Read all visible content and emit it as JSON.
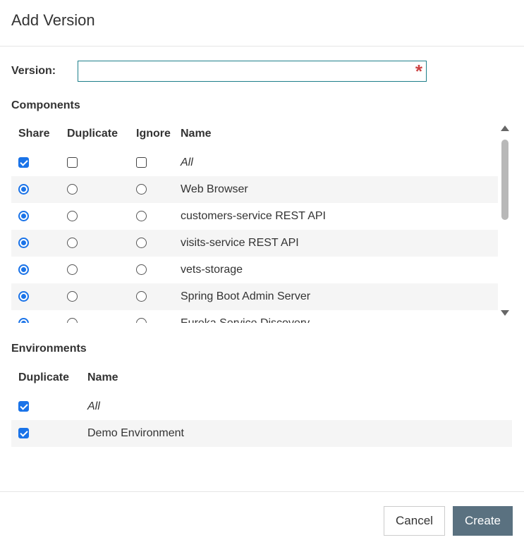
{
  "dialog": {
    "title": "Add Version"
  },
  "version": {
    "label": "Version:",
    "value": "",
    "required_mark": "*"
  },
  "components": {
    "title": "Components",
    "headers": {
      "share": "Share",
      "duplicate": "Duplicate",
      "ignore": "Ignore",
      "name": "Name"
    },
    "all_row": {
      "name": "All",
      "share": true,
      "duplicate": false,
      "ignore": false
    },
    "rows": [
      {
        "name": "Web Browser",
        "selected": "share"
      },
      {
        "name": "customers-service REST API",
        "selected": "share"
      },
      {
        "name": "visits-service REST API",
        "selected": "share"
      },
      {
        "name": "vets-storage",
        "selected": "share"
      },
      {
        "name": "Spring Boot Admin Server",
        "selected": "share"
      },
      {
        "name": "Eureka Service Discovery",
        "selected": "share"
      }
    ]
  },
  "environments": {
    "title": "Environments",
    "headers": {
      "duplicate": "Duplicate",
      "name": "Name"
    },
    "all_row": {
      "name": "All",
      "duplicate": true
    },
    "rows": [
      {
        "name": "Demo Environment",
        "duplicate": true
      }
    ]
  },
  "footer": {
    "cancel_label": "Cancel",
    "create_label": "Create"
  },
  "colors": {
    "accent": "#1a73e8",
    "primary_button": "#5a7180",
    "required": "#cc4444",
    "input_border": "#1e7f8a"
  }
}
